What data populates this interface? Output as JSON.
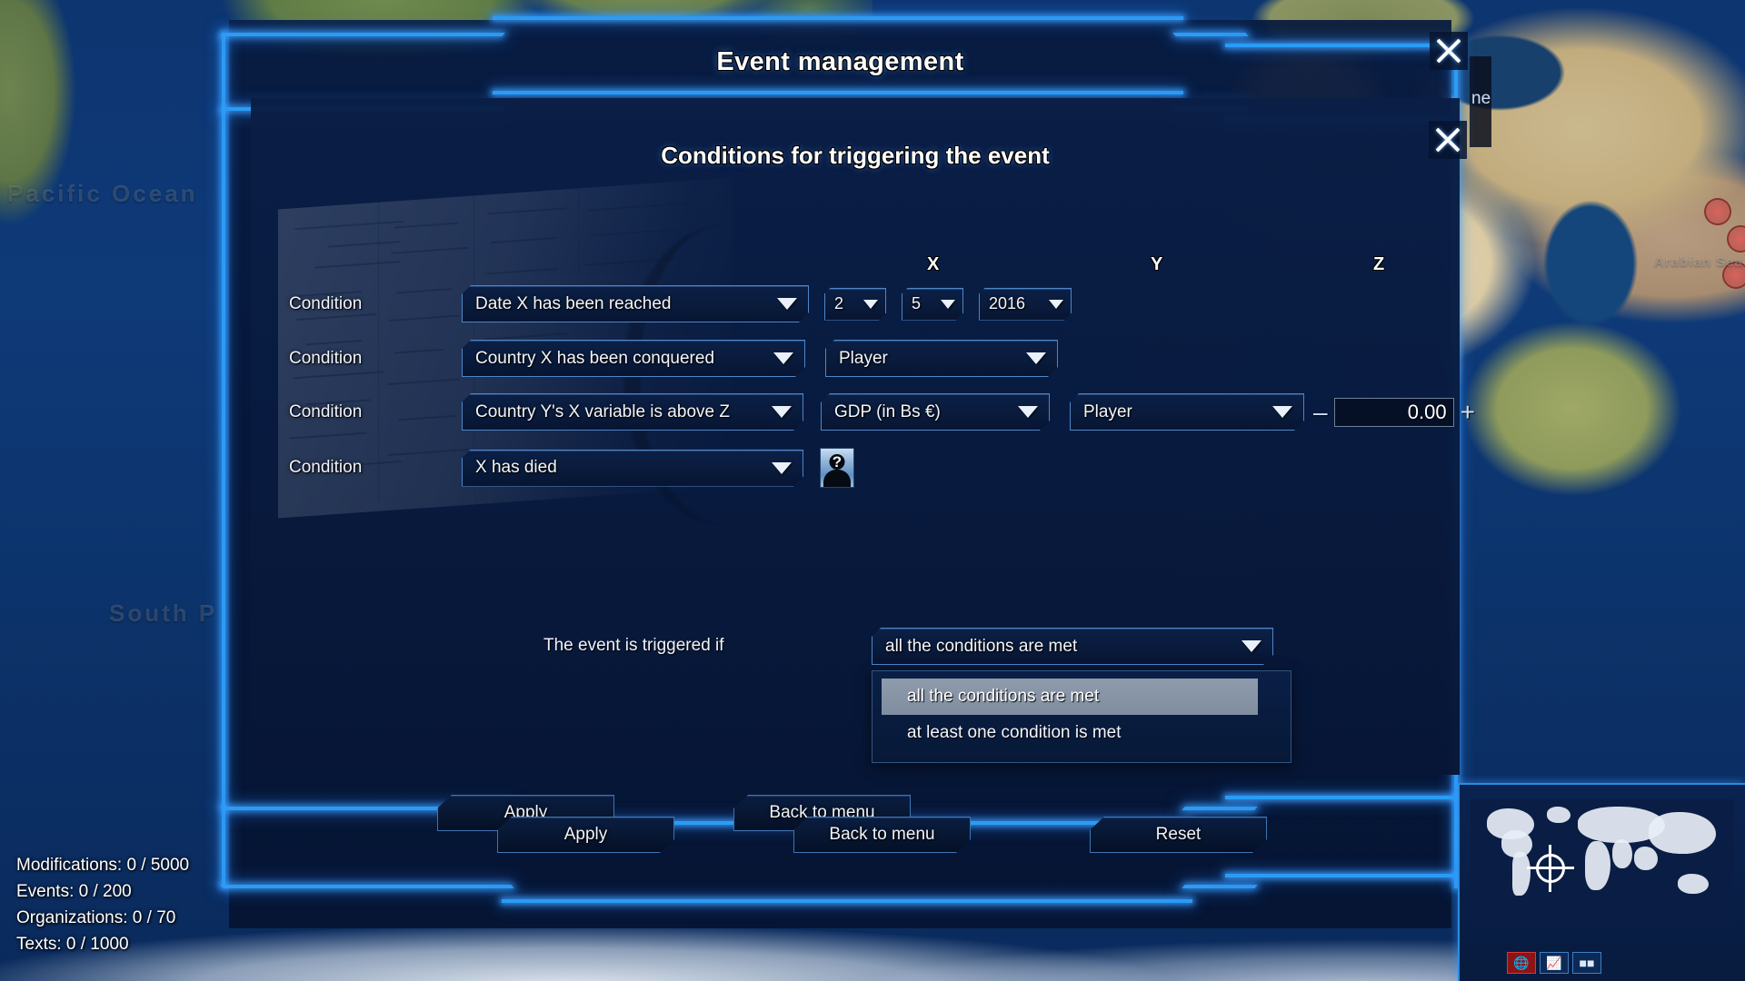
{
  "window": {
    "outer_title": "Event management",
    "inner_title": "Conditions for triggering the event",
    "close_label": "close"
  },
  "column_headers": {
    "x": "X",
    "y": "Y",
    "z": "Z"
  },
  "conditions": [
    {
      "label": "Condition",
      "type": "Date X has been reached",
      "day": "2",
      "month": "5",
      "year": "2016"
    },
    {
      "label": "Condition",
      "type": "Country X has been conquered",
      "target": "Player"
    },
    {
      "label": "Condition",
      "type": "Country Y's X variable is above Z",
      "variable": "GDP (in Bs €)",
      "target": "Player",
      "minus": "–",
      "value": "0.00",
      "plus": "+"
    },
    {
      "label": "Condition",
      "type": "X has died",
      "portrait": "unknown-person-icon"
    }
  ],
  "trigger": {
    "label": "The event is triggered if",
    "selected": "all the conditions are met",
    "options": [
      "all the conditions are met",
      "at least one condition is met"
    ]
  },
  "inner_buttons": {
    "apply": "Apply",
    "back": "Back to menu"
  },
  "outer_buttons": {
    "apply": "Apply",
    "back": "Back to menu",
    "reset": "Reset"
  },
  "stats": [
    "Modifications: 0 / 5000",
    "Events: 0 / 200",
    "Organizations: 0 / 70",
    "Texts: 0 / 1000"
  ],
  "map_labels": {
    "pacific": "Pacific Ocean",
    "south": "South P",
    "arabian": "Arabian Sea",
    "side_tab": "ne"
  },
  "minimap": {
    "icons": [
      "globe-icon",
      "chart-icon",
      "tank-icon"
    ]
  },
  "colors": {
    "neon": "#2a9cf5",
    "panel": "#081a3e",
    "text": "#f2f6fc",
    "selected_row": "#8e9bac",
    "red_marker": "#c83c3c"
  }
}
